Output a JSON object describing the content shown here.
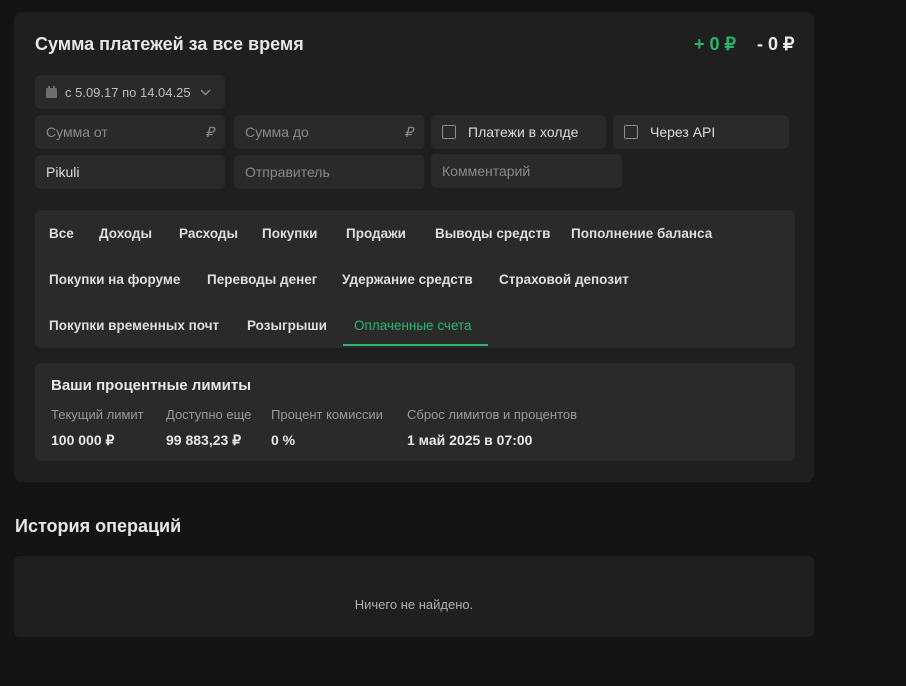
{
  "summary": {
    "title": "Сумма платежей за все время",
    "income": "+ 0 ₽",
    "expense": "- 0 ₽",
    "date_range": "с 5.09.17 по 14.04.25"
  },
  "filters": {
    "sum_from_placeholder": "Сумма от",
    "sum_to_placeholder": "Сумма до",
    "currency": "₽",
    "hold_label": "Платежи в холде",
    "api_label": "Через API",
    "user_value": "Pikuli",
    "sender_placeholder": "Отправитель",
    "comment_placeholder": "Комментарий"
  },
  "tabs": [
    {
      "label": "Все"
    },
    {
      "label": "Доходы"
    },
    {
      "label": "Расходы"
    },
    {
      "label": "Покупки"
    },
    {
      "label": "Продажи"
    },
    {
      "label": "Выводы средств"
    },
    {
      "label": "Пополнение баланса"
    },
    {
      "label": "Покупки на форуме"
    },
    {
      "label": "Переводы денег"
    },
    {
      "label": "Удержание средств"
    },
    {
      "label": "Страховой депозит"
    },
    {
      "label": "Покупки временных почт"
    },
    {
      "label": "Розыгрыши"
    },
    {
      "label": "Оплаченные счета"
    }
  ],
  "active_tab": "Оплаченные счета",
  "limits": {
    "title": "Ваши процентные лимиты",
    "items": [
      {
        "label": "Текущий лимит",
        "value": "100 000 ₽"
      },
      {
        "label": "Доступно еще",
        "value": "99 883,23 ₽"
      },
      {
        "label": "Процент комиссии",
        "value": "0 %"
      },
      {
        "label": "Сброс лимитов и процентов",
        "value": "1 май 2025 в 07:00"
      }
    ]
  },
  "history": {
    "title": "История операций",
    "empty_text": "Ничего не найдено."
  },
  "colors": {
    "accent": "#2bb673",
    "background": "#141414",
    "panel": "#1f1f1f",
    "card": "#2a2a2a"
  }
}
